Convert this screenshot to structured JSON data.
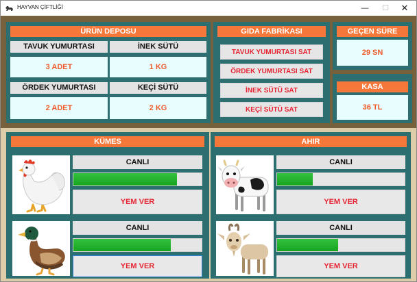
{
  "window": {
    "title": "HAYVAN ÇİFTLİĞİ",
    "min_glyph": "—",
    "max_glyph": "☐",
    "close_glyph": "✕"
  },
  "depo": {
    "title": "ÜRÜN DEPOSU",
    "items": [
      {
        "label": "TAVUK YUMURTASI",
        "value": "3 ADET"
      },
      {
        "label": "İNEK SÜTÜ",
        "value": "1 KG"
      },
      {
        "label": "ÖRDEK YUMURTASI",
        "value": "2 ADET"
      },
      {
        "label": "KEÇİ SÜTÜ",
        "value": "2 KG"
      }
    ]
  },
  "fabrika": {
    "title": "GIDA FABRİKASI",
    "buttons": [
      "TAVUK YUMURTASI SAT",
      "ÖRDEK YUMURTASI SAT",
      "İNEK SÜTÜ SAT",
      "KEÇİ SÜTÜ SAT"
    ]
  },
  "sure": {
    "title": "GEÇEN SÜRE",
    "value": "29 SN"
  },
  "kasa": {
    "title": "KASA",
    "value": "36 TL"
  },
  "kumes": {
    "title": "KÜMES",
    "animals": [
      {
        "icon": "chicken-icon",
        "status": "CANLI",
        "health": 0.81,
        "button": "YEM VER"
      },
      {
        "icon": "duck-icon",
        "status": "CANLI",
        "health": 0.76,
        "button": "YEM VER"
      }
    ]
  },
  "ahir": {
    "title": "AHIR",
    "animals": [
      {
        "icon": "cow-icon",
        "status": "CANLI",
        "health": 0.28,
        "button": "YEM VER"
      },
      {
        "icon": "goat-icon",
        "status": "CANLI",
        "health": 0.48,
        "button": "YEM VER"
      }
    ]
  },
  "colors": {
    "accent": "#f5783a",
    "teal": "#2d6e70",
    "value_text": "#ef5a2a",
    "button_text": "#e52333",
    "progress": "#1fae2a"
  }
}
